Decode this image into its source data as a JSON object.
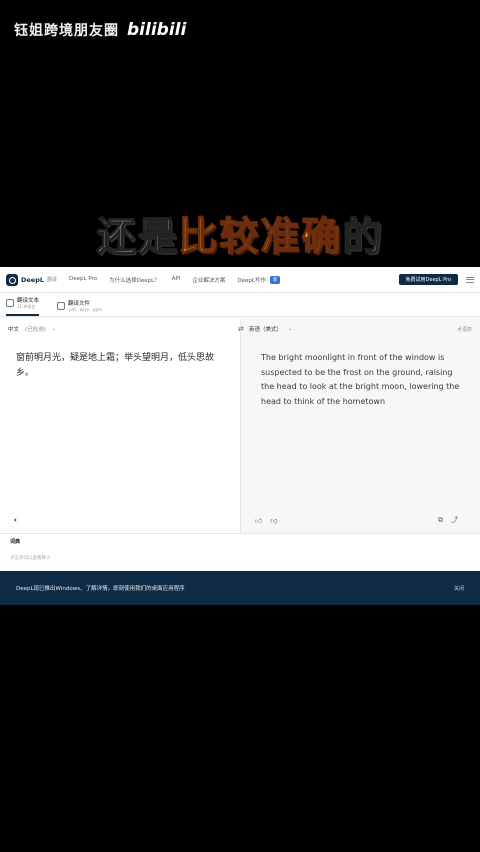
{
  "watermark": {
    "channel": "钰姐跨境朋友圈",
    "platform_logo": "bilibili"
  },
  "caption": {
    "part1": "还是",
    "part2": "比较准确",
    "part3": "的"
  },
  "nav": {
    "logo": "DeepL",
    "logo_sub": "翻译",
    "links": [
      "DeepL Pro",
      "为什么选择DeepL？",
      "API",
      "企业解决方案",
      "DeepL写作"
    ],
    "badge": "新",
    "cta": "免费试用DeepL Pro",
    "icons": {
      "logo": "deepl-logo-icon",
      "menu": "hamburger-menu-icon"
    }
  },
  "tabs": [
    {
      "label": "翻译文本",
      "sub": "31 种语言"
    },
    {
      "label": "翻译文件",
      "sub": ".pdf, .docx, .pptx"
    }
  ],
  "source": {
    "lang": "中文",
    "lang_sub": "(已检测)",
    "text": "窗前明月光，疑是地上霜；举头望明月，低头思故乡。"
  },
  "target": {
    "lang": "英语（美式）",
    "extra": "术语表",
    "text": "The bright moonlight in front of the window is suspected to be the frost on the ground, raising the head to look at the bright moon, lowering the head to think of the hometown"
  },
  "dictionary": {
    "title": "词典",
    "sub": "点击单词以查看释义"
  },
  "banner": {
    "text": "DeepL现已推出Windows、了解详情。即刻使用我们的桌面应用程序",
    "close": "关闭"
  }
}
